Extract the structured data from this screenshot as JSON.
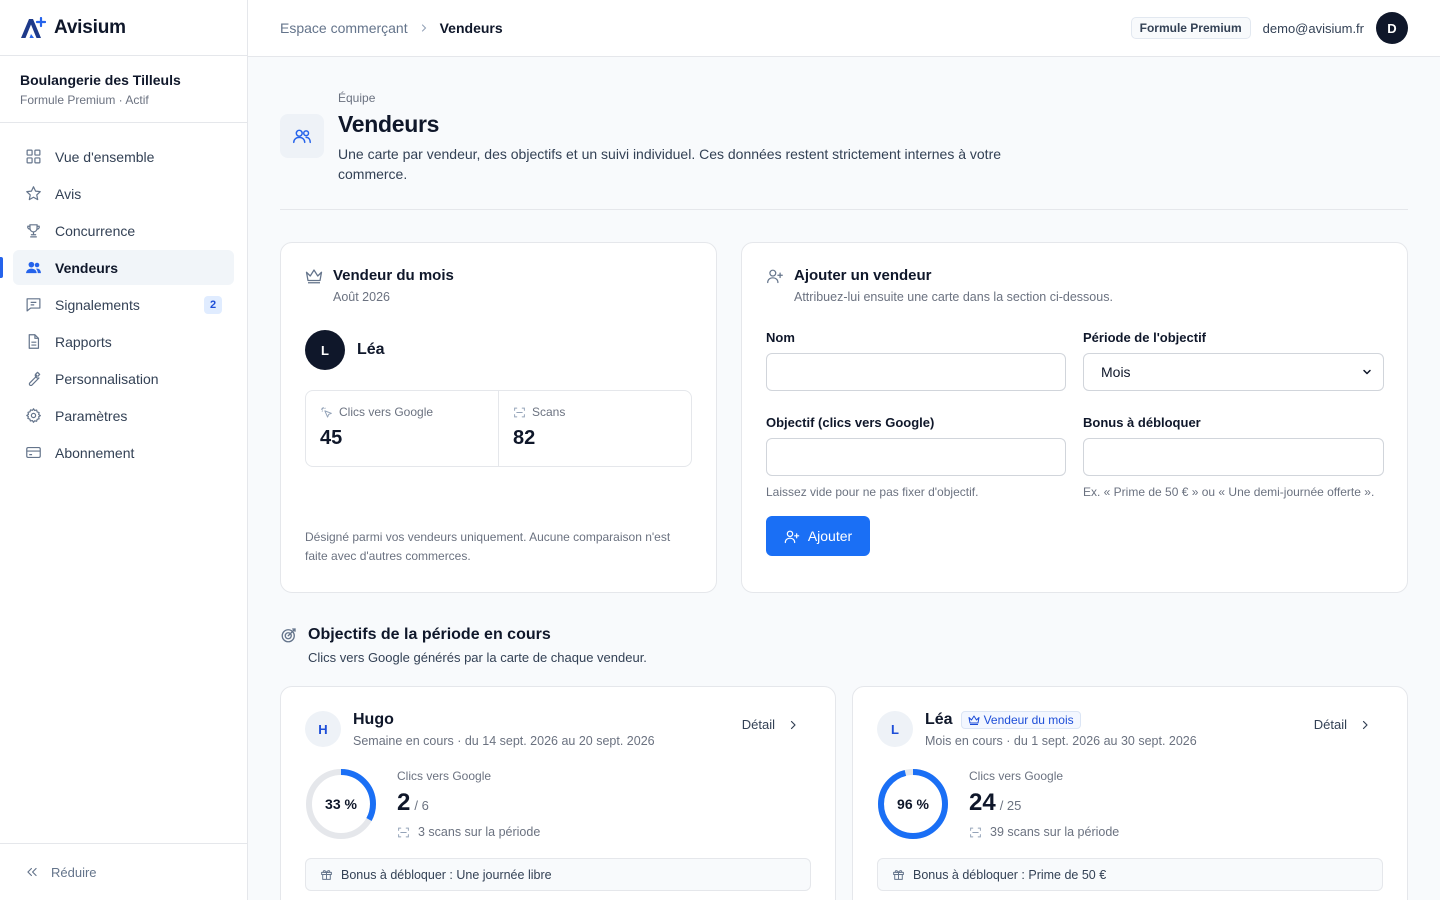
{
  "brand": {
    "name": "Avisium",
    "accent": "#2563eb"
  },
  "shop": {
    "name": "Boulangerie des Tilleuls",
    "plan_status": "Formule Premium · Actif"
  },
  "nav": [
    {
      "label": "Vue d'ensemble",
      "icon": "grid-icon"
    },
    {
      "label": "Avis",
      "icon": "star-icon"
    },
    {
      "label": "Concurrence",
      "icon": "trophy-icon"
    },
    {
      "label": "Vendeurs",
      "icon": "users-icon",
      "active": true
    },
    {
      "label": "Signalements",
      "icon": "message-icon",
      "badge": "2"
    },
    {
      "label": "Rapports",
      "icon": "document-icon"
    },
    {
      "label": "Personnalisation",
      "icon": "wrench-icon"
    },
    {
      "label": "Paramètres",
      "icon": "gear-icon"
    },
    {
      "label": "Abonnement",
      "icon": "card-icon"
    }
  ],
  "sidebar_footer": {
    "collapse_label": "Réduire"
  },
  "topbar": {
    "breadcrumb": [
      "Espace commerçant",
      "Vendeurs"
    ],
    "plan": "Formule Premium",
    "email": "demo@avisium.fr",
    "avatar_initial": "D"
  },
  "page": {
    "eyebrow": "Équipe",
    "title": "Vendeurs",
    "description": "Une carte par vendeur, des objectifs et un suivi individuel. Ces données restent strictement internes à votre commerce."
  },
  "seller_of_month": {
    "title": "Vendeur du mois",
    "subtitle": "Août 2026",
    "initial": "L",
    "name": "Léa",
    "clicks_label": "Clics vers Google",
    "clicks": "45",
    "scans_label": "Scans",
    "scans": "82",
    "note": "Désigné parmi vos vendeurs uniquement. Aucune comparaison n'est faite avec d'autres commerces."
  },
  "add_seller": {
    "title": "Ajouter un vendeur",
    "subtitle": "Attribuez-lui ensuite une carte dans la section ci-dessous.",
    "name_label": "Nom",
    "name_value": "",
    "period_label": "Période de l'objectif",
    "period_value": "Mois",
    "goal_label": "Objectif (clics vers Google)",
    "goal_value": "",
    "goal_hint": "Laissez vide pour ne pas fixer d'objectif.",
    "bonus_label": "Bonus à débloquer",
    "bonus_value": "",
    "bonus_hint": "Ex. « Prime de 50 € » ou « Une demi-journée offerte ».",
    "submit_label": "Ajouter"
  },
  "goals": {
    "title": "Objectifs de la période en cours",
    "subtitle": "Clics vers Google générés par la carte de chaque vendeur.",
    "sellers": [
      {
        "initial": "H",
        "name": "Hugo",
        "period": "Semaine en cours · du 14 sept. 2026 au 20 sept. 2026",
        "detail_label": "Détail",
        "percent_label": "33 %",
        "progress": 0.33,
        "metric_label": "Clics vers Google",
        "value": "2",
        "goal": "/ 6",
        "scans": "3 scans sur la période",
        "bonus": "Bonus à débloquer : Une journée libre"
      },
      {
        "initial": "L",
        "name": "Léa",
        "tag": "Vendeur du mois",
        "period": "Mois en cours · du 1 sept. 2026 au 30 sept. 2026",
        "detail_label": "Détail",
        "percent_label": "96 %",
        "progress": 0.96,
        "metric_label": "Clics vers Google",
        "value": "24",
        "goal": "/ 25",
        "scans": "39 scans sur la période",
        "bonus": "Bonus à débloquer : Prime de 50 €"
      }
    ]
  }
}
